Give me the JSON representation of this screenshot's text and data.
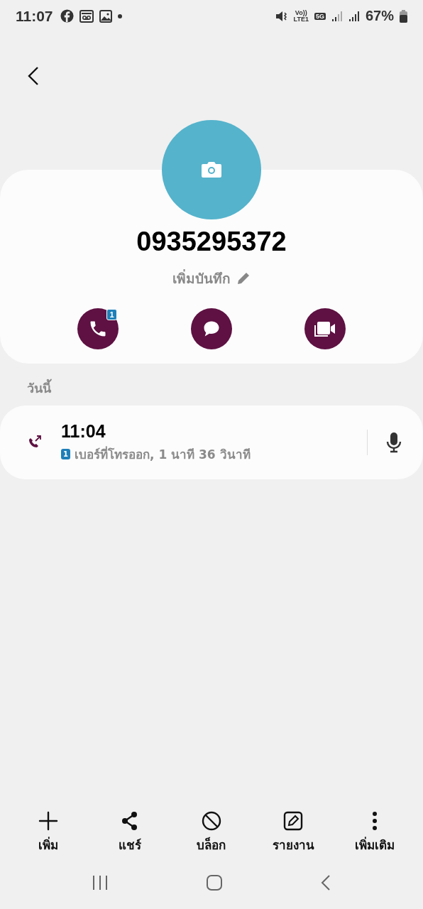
{
  "status_bar": {
    "time": "11:07",
    "volte": "Vo))",
    "lte": "LTE1",
    "network": "5G",
    "battery": "67%"
  },
  "contact": {
    "number": "0935295372",
    "add_note": "เพิ่มบันทึก",
    "call_badge": "1"
  },
  "section_title": "วันนี้",
  "call_log": [
    {
      "time": "11:04",
      "sim": "1",
      "detail": "เบอร์ที่โทรออก, 1 นาที 36 วินาที"
    }
  ],
  "toolbar": [
    {
      "kind": "add",
      "label": "เพิ่ม"
    },
    {
      "kind": "share",
      "label": "แชร์"
    },
    {
      "kind": "block",
      "label": "บล็อก"
    },
    {
      "kind": "report",
      "label": "รายงาน"
    },
    {
      "kind": "more",
      "label": "เพิ่มเติม"
    }
  ]
}
